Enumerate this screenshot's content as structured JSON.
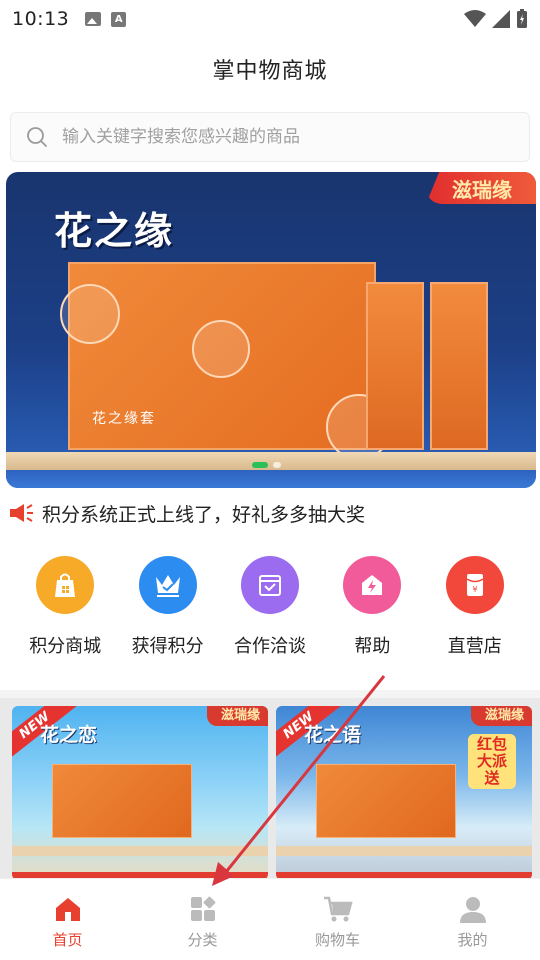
{
  "status_bar": {
    "time": "10:13"
  },
  "header": {
    "title": "掌中物商城"
  },
  "search": {
    "placeholder": "输入关键字搜索您感兴趣的商品"
  },
  "banner": {
    "title": "花之缘",
    "badge": "滋瑞缘",
    "box_label": "花之缘套"
  },
  "notice": {
    "text": "积分系统正式上线了，好礼多多抽大奖"
  },
  "quick_menu": [
    {
      "label": "积分商城",
      "color": "#f7a928",
      "icon": "shopping-bag-icon"
    },
    {
      "label": "获得积分",
      "color": "#2d8cf0",
      "icon": "crown-icon"
    },
    {
      "label": "合作洽谈",
      "color": "#9b6cf0",
      "icon": "message-box-icon"
    },
    {
      "label": "帮助",
      "color": "#f25b9a",
      "icon": "lightning-house-icon"
    },
    {
      "label": "直营店",
      "color": "#f2483c",
      "icon": "yuan-envelope-icon"
    }
  ],
  "products": [
    {
      "title": "花之恋",
      "badge": "滋瑞缘",
      "new_tag": "NEW"
    },
    {
      "title": "花之语",
      "badge": "滋瑞缘",
      "new_tag": "NEW",
      "promo": "红包大派送"
    }
  ],
  "tabbar": [
    {
      "label": "首页",
      "icon": "home-icon",
      "active": true
    },
    {
      "label": "分类",
      "icon": "category-icon",
      "active": false
    },
    {
      "label": "购物车",
      "icon": "cart-icon",
      "active": false
    },
    {
      "label": "我的",
      "icon": "user-icon",
      "active": false
    }
  ],
  "colors": {
    "accent": "#e8402e",
    "annotation_arrow": "#d9363e"
  }
}
